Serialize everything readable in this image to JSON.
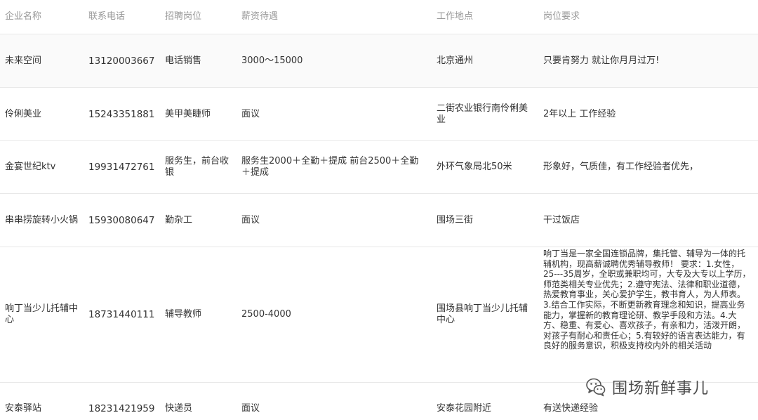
{
  "table": {
    "headers": [
      "企业名称",
      "联系电话",
      "招聘岗位",
      "薪资待遇",
      "工作地点",
      "岗位要求"
    ],
    "rows": [
      {
        "company": "未来空间",
        "phone": "13120003667",
        "position": "电话销售",
        "salary": "3000～15000",
        "location": "北京通州",
        "requirements": "只要肯努力 就让你月月过万!"
      },
      {
        "company": "伶俐美业",
        "phone": "15243351881",
        "position": "美甲美睫师",
        "salary": "面议",
        "location": "二街农业银行南伶俐美业",
        "requirements": "2年以上 工作经验"
      },
      {
        "company": "金宴世纪ktv",
        "phone": "19931472761",
        "position": "服务生，前台收银",
        "salary": "服务生2000＋全勤＋提成 前台2500＋全勤＋提成",
        "location": "外环气象局北50米",
        "requirements": "形象好，气质佳，有工作经验者优先，"
      },
      {
        "company": "串串捞旋转小火锅",
        "phone": "15930080647",
        "position": "勤杂工",
        "salary": "面议",
        "location": "围场三街",
        "requirements": "干过饭店"
      },
      {
        "company": "响丁当少儿托辅中心",
        "phone": "18731440111",
        "position": "辅导教师",
        "salary": "2500-4000",
        "location": "围场县响丁当少儿托辅中心",
        "requirements": "响丁当是一家全国连锁品牌，集托管、辅导为一体的托辅机构，现高薪诚聘优秀辅导教师！ 要求：1.女性，25---35周岁，全职或兼职均可，大专及大专以上学历，师范类相关专业优先；2.遵守宪法、法律和职业道德，热爱教育事业，关心爱护学生，教书育人，为人师表。3.结合工作实际，不断更新教育理念和知识，提高业务能力，掌握新的教育理论研、教学手段和方法。4.大方、稳重、有爱心、喜欢孩子，有亲和力，活泼开朗，对孩子有耐心和责任心；5.有较好的语言表达能力，有良好的服务意识，积极支持校内外的相关活动"
      },
      {
        "company": "安泰驿站",
        "phone": "18231421959",
        "position": "快递员",
        "salary": "面议",
        "location": "安泰花园附近",
        "requirements": "有送快递经验"
      }
    ]
  },
  "watermark": {
    "text": "围场新鲜事儿",
    "icon": "wechat-icon"
  }
}
